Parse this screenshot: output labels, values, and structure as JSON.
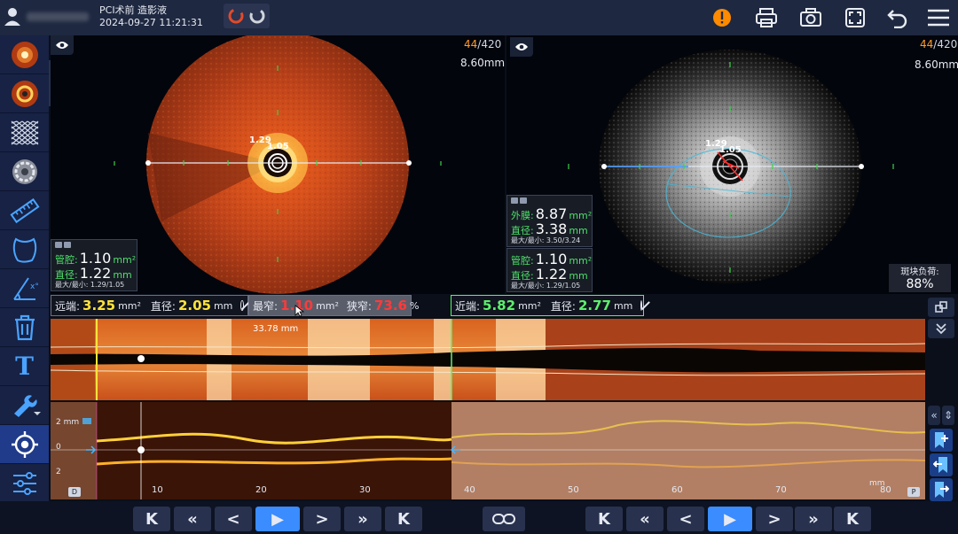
{
  "header": {
    "procedure": "PCI术前 造影液",
    "timestamp": "2024-09-27 11:21:31",
    "icons": [
      "user-icon",
      "oct-mode-logo",
      "alert-icon",
      "print-icon",
      "camera-icon",
      "fullscreen-icon",
      "back-icon",
      "menu-icon"
    ]
  },
  "sidebar": {
    "items": [
      "vessel-view-icon",
      "lumen-view-icon",
      "mesh-icon",
      "stent-icon",
      "ruler-icon",
      "region-outline-icon",
      "angle-measure-icon",
      "trash-icon",
      "text-tool-icon",
      "wrench-icon",
      "crosshair-icon",
      "sliders-icon",
      "add-icon"
    ],
    "text_tool": "T"
  },
  "left_panel": {
    "frame_current": "44",
    "frame_total": "/420",
    "depth": "8.60mm",
    "lumen_label_a": "1.29",
    "lumen_label_b": "1.05",
    "measure": {
      "area_label": "管腔:",
      "area_value": "1.10",
      "area_unit": "mm²",
      "diam_label": "直径:",
      "diam_value": "1.22",
      "diam_unit": "mm",
      "minmax": "最大/最小: 1.29/1.05"
    }
  },
  "right_panel": {
    "frame_current": "44",
    "frame_total": "/420",
    "depth": "8.60mm",
    "lumen_label_a": "1.29",
    "lumen_label_b": "1.05",
    "eem": {
      "area_label": "外膜:",
      "area_value": "8.87",
      "area_unit": "mm²",
      "diam_label": "直径:",
      "diam_value": "3.38",
      "diam_unit": "mm",
      "minmax": "最大/最小: 3.50/3.24"
    },
    "lumen": {
      "area_label": "管腔:",
      "area_value": "1.10",
      "area_unit": "mm²",
      "diam_label": "直径:",
      "diam_value": "1.22",
      "diam_unit": "mm",
      "minmax": "最大/最小: 1.29/1.05"
    },
    "plaque_label": "斑块负荷:",
    "plaque_value": "88%"
  },
  "measure_bar": {
    "distal_label": "远端:",
    "distal_area": "3.25",
    "distal_diam_label": "直径:",
    "distal_diam": "2.05",
    "narrowest_label": "最窄:",
    "narrowest_area": "1.10",
    "stenosis_label": "狭窄:",
    "stenosis_value": "73.6",
    "stenosis_unit": "%",
    "proximal_label": "近端:",
    "proximal_area": "5.82",
    "proximal_diam_label": "直径:",
    "proximal_diam": "2.77",
    "area_unit": "mm²",
    "diam_unit": "mm",
    "length": "33.78 mm"
  },
  "long_view": {
    "scale_2mm_top": "2 mm",
    "scale_0": "0",
    "scale_2_bottom": "2",
    "x_ticks": [
      "10",
      "20",
      "30",
      "40",
      "50",
      "60",
      "70",
      "80"
    ],
    "unit": "mm",
    "corner_left": "D",
    "corner_right": "P"
  },
  "playback": {
    "left_buttons": [
      "K",
      "«",
      "<",
      "▶",
      ">",
      "»",
      "K"
    ],
    "link": "link-icon",
    "right_buttons": [
      "K",
      "«",
      "<",
      "▶",
      ">",
      "»",
      "K"
    ]
  },
  "colors": {
    "accent_blue": "#3a8cff",
    "yellow": "#ffe33a",
    "green": "#5cf06c",
    "red": "#ff3a3a",
    "orange": "#ff9c2a"
  }
}
